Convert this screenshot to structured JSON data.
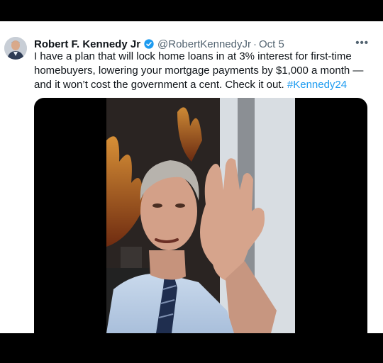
{
  "tweet": {
    "author_name": "Robert F. Kennedy Jr",
    "handle": "@RobertKennedyJr",
    "separator": "·",
    "date": "Oct 5",
    "more_label": "•••",
    "text": "I have a plan that will lock home loans in at 3% interest for first-time homebuyers, lowering your mortgage payments by $1,000 a month — and it won’t cost the government a cent. Check it out.",
    "hashtag": "#Kennedy24"
  },
  "colors": {
    "verified_badge": "#1d9bf0",
    "hashtag": "#1d9bf0",
    "secondary_text": "#536471",
    "primary_text": "#0f1419"
  },
  "icons": {
    "verified": "verified-badge-icon",
    "more": "more-options-icon"
  }
}
